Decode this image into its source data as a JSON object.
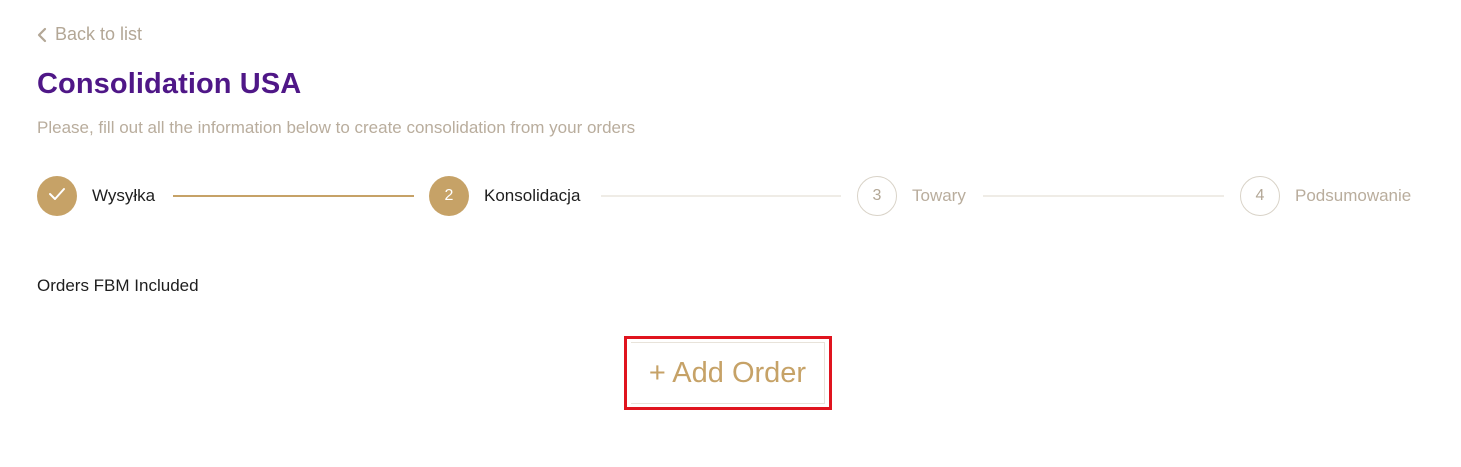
{
  "nav": {
    "back_label": "Back to list",
    "back_icon": "chevron-left-icon"
  },
  "header": {
    "title": "Consolidation USA",
    "subtitle": "Please, fill out all the information below to create consolidation from your orders"
  },
  "stepper": {
    "steps": [
      {
        "number": "",
        "label": "Wysyłka",
        "state": "done",
        "icon": "check-icon"
      },
      {
        "number": "2",
        "label": "Konsolidacja",
        "state": "active"
      },
      {
        "number": "3",
        "label": "Towary",
        "state": "pending"
      },
      {
        "number": "4",
        "label": "Podsumowanie",
        "state": "pending"
      }
    ]
  },
  "orders_section": {
    "label": "Orders FBM Included",
    "add_button_label": "+ Add Order"
  },
  "colors": {
    "title": "#4f1787",
    "accent": "#c6a267",
    "muted_text": "#b9ad9d",
    "highlight_border": "#e0141e"
  }
}
